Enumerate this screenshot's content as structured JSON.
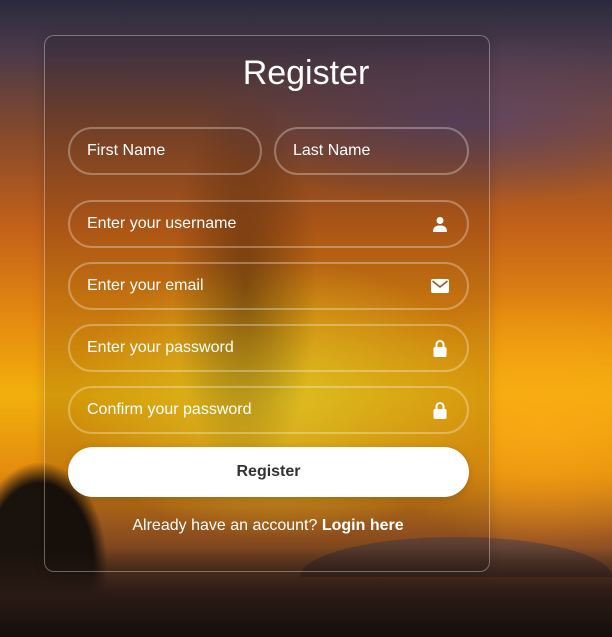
{
  "form": {
    "title": "Register",
    "first_name": {
      "placeholder": "First Name",
      "value": ""
    },
    "last_name": {
      "placeholder": "Last Name",
      "value": ""
    },
    "username": {
      "placeholder": "Enter your username",
      "value": "",
      "icon": "user-icon"
    },
    "email": {
      "placeholder": "Enter your email",
      "value": "",
      "icon": "envelope-icon"
    },
    "password": {
      "placeholder": "Enter your password",
      "value": "",
      "icon": "lock-icon"
    },
    "confirm_password": {
      "placeholder": "Confirm your password",
      "value": "",
      "icon": "lock-icon"
    },
    "submit_label": "Register",
    "login_prompt": "Already have an account?",
    "login_link": "Login here"
  },
  "colors": {
    "text": "#ffffff",
    "button_bg": "#ffffff",
    "button_text": "#333333",
    "field_border": "rgba(255,255,255,0.3)"
  }
}
